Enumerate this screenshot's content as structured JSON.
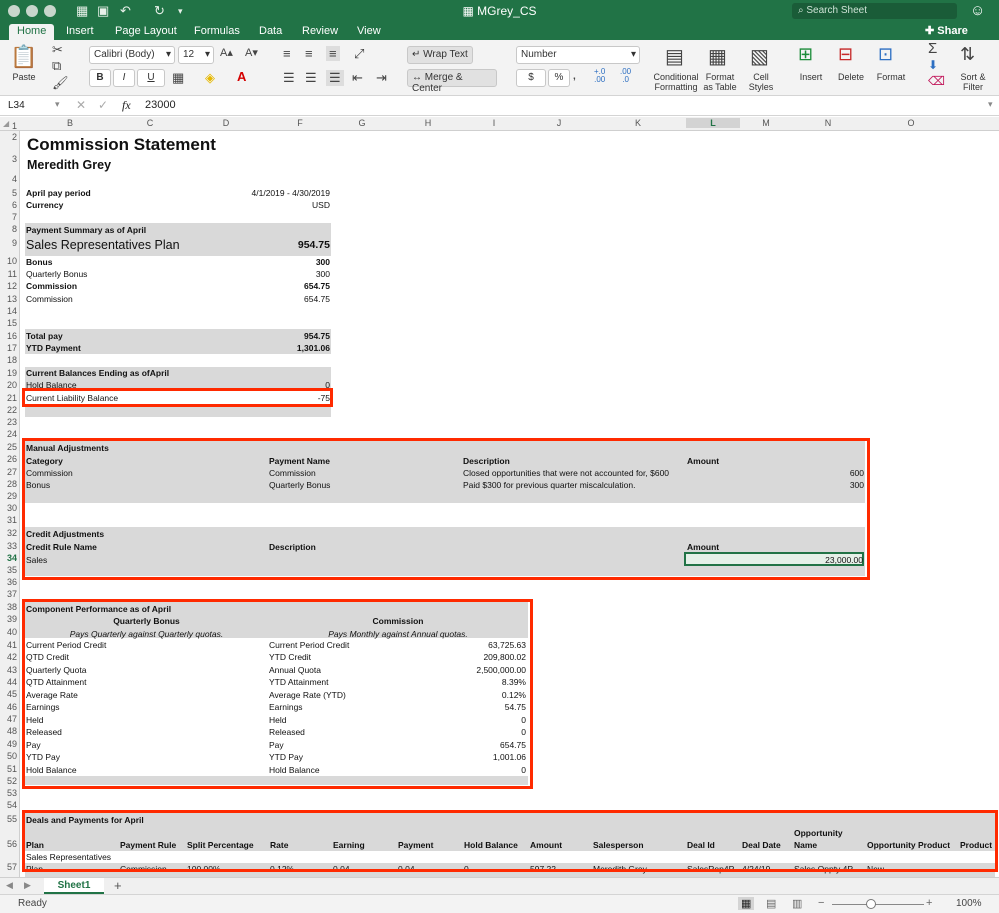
{
  "app": {
    "title": "MGrey_CS",
    "search_placeholder": "Search Sheet",
    "share_label": "Share",
    "ribbon_tabs": [
      "Home",
      "Insert",
      "Page Layout",
      "Formulas",
      "Data",
      "Review",
      "View"
    ],
    "active_tab": "Home"
  },
  "ribbon": {
    "paste": "Paste",
    "font_name": "Calibri (Body)",
    "font_size": "12",
    "wrap_text": "Wrap Text",
    "merge_center": "Merge & Center",
    "number_format": "Number",
    "conditional_formatting": [
      "Conditional",
      "Formatting"
    ],
    "format_as_table": [
      "Format",
      "as Table"
    ],
    "cell_styles": [
      "Cell",
      "Styles"
    ],
    "insert": "Insert",
    "delete": "Delete",
    "format": "Format",
    "sort_filter": [
      "Sort &",
      "Filter"
    ],
    "bold": "B",
    "italic": "I",
    "underline": "U",
    "currency": "$",
    "percent": "%",
    "inc_decimal": "+.0\n.00",
    "dec_decimal": ".00\n→.0"
  },
  "formula_bar": {
    "cell_ref": "L34",
    "fx": "fx",
    "value": "23000"
  },
  "columns": [
    "B",
    "C",
    "D",
    "F",
    "G",
    "H",
    "I",
    "J",
    "K",
    "L",
    "M",
    "N",
    "O"
  ],
  "rows": [
    "1",
    "2",
    "3",
    "4",
    "5",
    "6",
    "7",
    "8",
    "9",
    "10",
    "11",
    "12",
    "13",
    "14",
    "15",
    "16",
    "17",
    "18",
    "19",
    "20",
    "21",
    "22",
    "23",
    "24",
    "25",
    "26",
    "27",
    "28",
    "29",
    "30",
    "31",
    "32",
    "33",
    "34",
    "35",
    "36",
    "37",
    "38",
    "39",
    "40",
    "41",
    "42",
    "43",
    "44",
    "45",
    "46",
    "47",
    "48",
    "49",
    "50",
    "51",
    "52",
    "53",
    "54",
    "55",
    "56",
    "57"
  ],
  "sheet": {
    "title": "Commission Statement",
    "name": "Meredith Grey",
    "period_label": "April pay period",
    "period_value": "4/1/2019 - 4/30/2019",
    "currency_label": "Currency",
    "currency_value": "USD",
    "payment_summary": {
      "header": "Payment Summary as of April",
      "plan": "Sales Representatives Plan",
      "plan_value": "954.75",
      "rows": [
        {
          "label": "Bonus",
          "value": "300",
          "bold": true
        },
        {
          "label": "Quarterly Bonus",
          "value": "300",
          "bold": false
        },
        {
          "label": "Commission",
          "value": "654.75",
          "bold": true
        },
        {
          "label": "Commission",
          "value": "654.75",
          "bold": false
        }
      ],
      "total_pay_label": "Total pay",
      "total_pay_value": "954.75",
      "ytd_label": "YTD Payment",
      "ytd_value": "1,301.06"
    },
    "balances": {
      "header": "Current Balances Ending as ofApril",
      "hold_label": "Hold Balance",
      "hold_value": "0",
      "liability_label": "Current Liability Balance",
      "liability_value": "-75"
    },
    "manual_adjustments": {
      "header": "Manual Adjustments",
      "columns": [
        "Category",
        "Payment Name",
        "Description",
        "Amount"
      ],
      "rows": [
        {
          "category": "Commission",
          "payment": "Commission",
          "description": "Closed opportunities that were not accounted for, $600",
          "amount": "600"
        },
        {
          "category": "Bonus",
          "payment": "Quarterly Bonus",
          "description": "Paid $300 for previous quarter miscalculation.",
          "amount": "300"
        }
      ]
    },
    "credit_adjustments": {
      "header": "Credit Adjustments",
      "columns": [
        "Credit Rule Name",
        "Description",
        "Amount"
      ],
      "rows": [
        {
          "rule": "Sales",
          "description": "",
          "amount": "23,000.00"
        }
      ]
    },
    "component_performance": {
      "header": "Component Performance as of April",
      "left_title": "Quarterly Bonus",
      "left_subtitle": "Pays Quarterly against Quarterly quotas.",
      "right_title": "Commission",
      "right_subtitle": "Pays Monthly against Annual quotas.",
      "left_rows": [
        "Current Period Credit",
        "QTD Credit",
        "Quarterly Quota",
        "QTD Attainment",
        "Average Rate",
        "Earnings",
        "Held",
        "Released",
        "Pay",
        "YTD Pay",
        "Hold Balance"
      ],
      "right_rows": [
        {
          "label": "Current Period Credit",
          "value": "63,725.63"
        },
        {
          "label": "YTD Credit",
          "value": "209,800.02"
        },
        {
          "label": "Annual Quota",
          "value": "2,500,000.00"
        },
        {
          "label": "YTD Attainment",
          "value": "8.39%"
        },
        {
          "label": "Average Rate (YTD)",
          "value": "0.12%"
        },
        {
          "label": "Earnings",
          "value": "54.75"
        },
        {
          "label": "Held",
          "value": "0"
        },
        {
          "label": "Released",
          "value": "0"
        },
        {
          "label": "Pay",
          "value": "654.75"
        },
        {
          "label": "YTD Pay",
          "value": "1,001.06"
        },
        {
          "label": "Hold Balance",
          "value": "0"
        }
      ]
    },
    "deals": {
      "header": "Deals and Payments for April",
      "columns": [
        "Plan",
        "Payment Rule",
        "Split Percentage",
        "Rate",
        "Earning",
        "Payment",
        "Hold Balance",
        "Amount",
        "Salesperson",
        "Deal Id",
        "Deal Date",
        "Opportunity Name",
        "Opportunity Product",
        "Product"
      ],
      "plan_row": "Sales Representatives",
      "partial_row": [
        "Plan",
        "Commission",
        "100.00%",
        "0.12%",
        "0.04",
        "0.04",
        "0",
        "597.22",
        "Meredith Grey",
        "SalesRep4P",
        "4/24/19",
        "Sales Oppty 4P",
        "New",
        ""
      ]
    }
  },
  "sheet_tab": "Sheet1",
  "add_sheet": "+",
  "status": {
    "ready": "Ready",
    "zoom": "100%"
  },
  "colors": {
    "excel_green": "#217346",
    "highlight_red": "#ff2a00",
    "band_gray": "#d9d9d9"
  }
}
